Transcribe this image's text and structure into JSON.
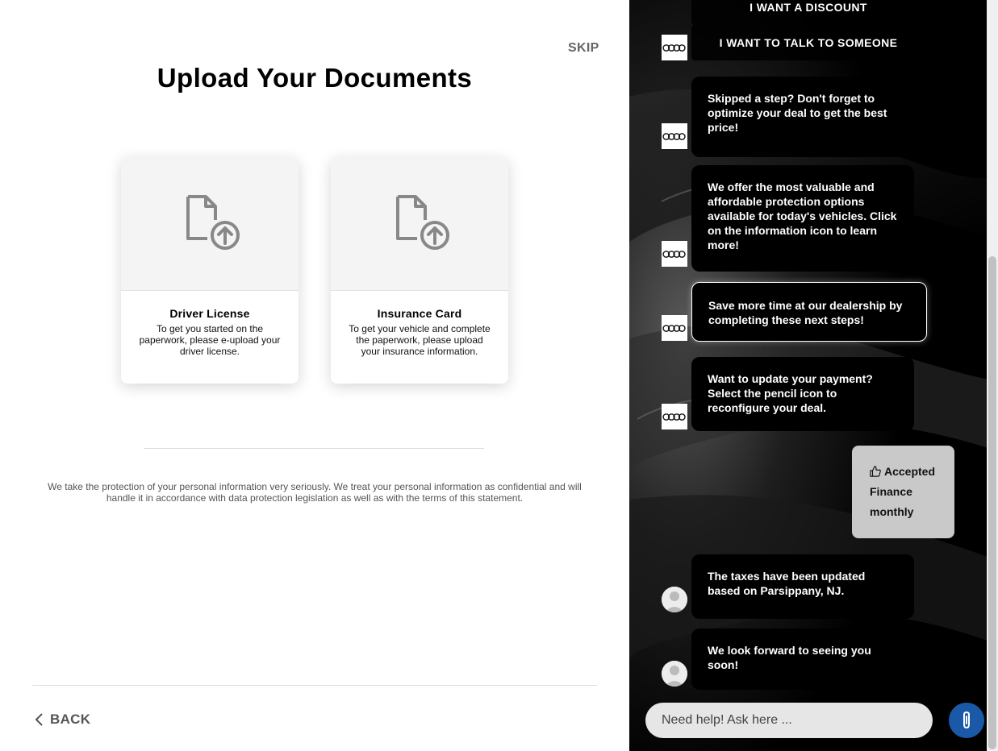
{
  "left": {
    "skip_label": "SKIP",
    "title": "Upload Your Documents",
    "cards": [
      {
        "title": "Driver License",
        "desc": "To get you started on the paperwork, please e-upload your driver license."
      },
      {
        "title": "Insurance Card",
        "desc": "To get your vehicle and complete the paperwork, please upload your insurance information."
      }
    ],
    "privacy": "We take the protection of your personal information very seriously. We treat your personal information as confidential and will handle it in accordance with data protection legislation as well as with the terms of this statement.",
    "back_label": "BACK"
  },
  "chat": {
    "options": [
      "I WANT A DISCOUNT",
      "I WANT TO TALK TO SOMEONE"
    ],
    "messages": [
      {
        "text": "Skipped a step? Don't forget to optimize your deal to get the best price!"
      },
      {
        "text": "We offer the most valuable and affordable protection options available for today's vehicles. Click on the information icon to learn more!"
      },
      {
        "text": "Save more time at our dealership by completing these next steps!"
      },
      {
        "text": "Want to update your payment? Select the pencil icon to reconfigure your deal."
      },
      {
        "text": "The taxes have been updated based on Parsippany, NJ."
      },
      {
        "text": "We look forward to seeing you soon!"
      }
    ],
    "reply": {
      "line1": "Accepted",
      "line2": "Finance",
      "line3": "monthly"
    },
    "input_placeholder": "Need help! Ask here ...",
    "icons": {
      "brand": "four-rings-logo-icon",
      "user": "user-avatar-icon",
      "attach": "paperclip-icon",
      "upload": "file-upload-icon",
      "back": "chevron-left-icon",
      "thumb": "thumbs-up-icon"
    },
    "colors": {
      "attach_button": "#1a59a8",
      "reply_bubble": "#c9c9c9"
    }
  }
}
